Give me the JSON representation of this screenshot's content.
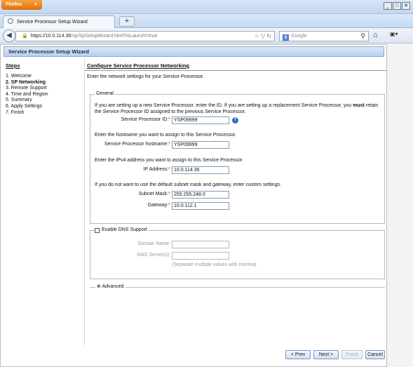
{
  "browser": {
    "app_button": "Firefox",
    "tab_title": "Service Processor Setup Wizard",
    "url_host": "https://10.0.114.36",
    "url_path": "/sp/SpSetupWizard.html?isLaunch=true",
    "search_placeholder": "Google"
  },
  "wizard": {
    "header_title": "Service Processor Setup Wizard",
    "steps_title": "Steps",
    "steps": [
      {
        "label": "1.  Welcome"
      },
      {
        "label": "2.  SP Networking"
      },
      {
        "label": "3.  Remote Support"
      },
      {
        "label": "4.  Time and Region"
      },
      {
        "label": "5.  Summary"
      },
      {
        "label": "6.  Apply Settings"
      },
      {
        "label": "7.  Finish"
      }
    ],
    "current_step_index": 1,
    "content_title": "Configure Service Processor Networking",
    "intro": "Enter the network settings for your Service Processor."
  },
  "general": {
    "legend": "General",
    "id_text_1": "If you are setting up a new Service Processor, enter the ID. If you are setting up a replacement Service Processor, you",
    "id_text_must": "must",
    "id_text_2": "retain the Service Processor ID assigned to the previous Service Processor.",
    "sp_id_label": "Service Processor ID:",
    "sp_id_value": "YSP09999",
    "hostname_text": "Enter the hostname you want to assign to this Service Processor.",
    "hostname_label": "Service Processor hostname:",
    "hostname_value": "YSP09999",
    "ip_text": "Enter the IPv4 address you want to assign to this Service Processor.",
    "ip_label": "IP Address:",
    "ip_value": "10.0.114.36",
    "mask_text": "If you do not want to use the default subnet mask and gateway, enter custom settings.",
    "mask_label": "Subnet Mask:",
    "mask_value": "255.255.248.0",
    "gateway_label": "Gateway:",
    "gateway_value": "10.0.112.1",
    "required_mark": "*"
  },
  "dns": {
    "legend": "Enable DNS Support",
    "checked": false,
    "domain_label": "Domain Name:",
    "domain_value": "",
    "servers_label": "DNS Server(s):",
    "servers_value": "",
    "hint": "(Separate multiple values with comma)"
  },
  "advanced": {
    "label": "Advanced"
  },
  "buttons": {
    "prev": "< Prev",
    "next": "Next >",
    "finish": "Finish",
    "cancel": "Cancel"
  }
}
